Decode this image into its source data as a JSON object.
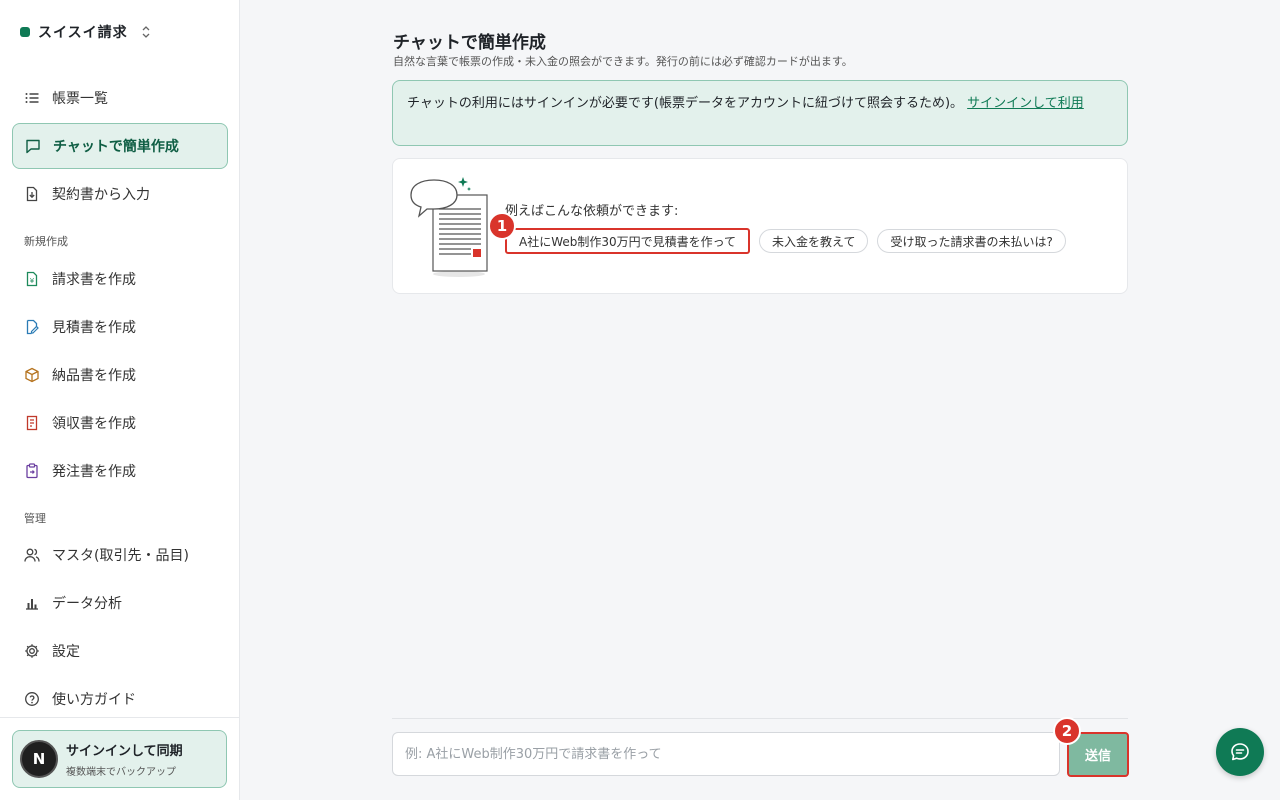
{
  "brand": {
    "name": "スイスイ請求"
  },
  "sidebar": {
    "items": [
      {
        "label": "帳票一覧",
        "icon": "list-icon"
      },
      {
        "label": "チャットで簡単作成",
        "icon": "chat-icon"
      },
      {
        "label": "契約書から入力",
        "icon": "file-import-icon"
      }
    ],
    "section_new": "新規作成",
    "new_items": [
      {
        "label": "請求書を作成",
        "icon": "invoice-icon"
      },
      {
        "label": "見積書を作成",
        "icon": "estimate-icon"
      },
      {
        "label": "納品書を作成",
        "icon": "box-icon"
      },
      {
        "label": "領収書を作成",
        "icon": "receipt-icon"
      },
      {
        "label": "発注書を作成",
        "icon": "clipboard-icon"
      }
    ],
    "section_manage": "管理",
    "manage_items": [
      {
        "label": "マスタ(取引先・品目)",
        "icon": "users-icon"
      },
      {
        "label": "データ分析",
        "icon": "bar-chart-icon"
      },
      {
        "label": "設定",
        "icon": "gear-icon"
      },
      {
        "label": "使い方ガイド",
        "icon": "help-icon"
      }
    ],
    "user": {
      "avatar": "N",
      "title": "サインインして同期",
      "subtitle": "複数端末でバックアップ"
    }
  },
  "main": {
    "title": "チャットで簡単作成",
    "subtitle": "自然な言葉で帳票の作成・未入金の照会ができます。発行の前には必ず確認カードが出ます。",
    "notice_text": "チャットの利用にはサインインが必要です(帳票データをアカウントに紐づけて照会するため)。",
    "notice_link": "サインインして利用",
    "examples_label": "例えばこんな依頼ができます:",
    "examples": [
      "A社にWeb制作30万円で見積書を作って",
      "未入金を教えて",
      "受け取った請求書の未払いは?"
    ],
    "badge1": "1",
    "badge2": "2",
    "input_placeholder": "例: A社にWeb制作30万円で請求書を作って",
    "send_label": "送信"
  },
  "colors": {
    "accent": "#0f7a55",
    "highlight": "#d9342b",
    "active_bg": "#e3f1ec"
  }
}
